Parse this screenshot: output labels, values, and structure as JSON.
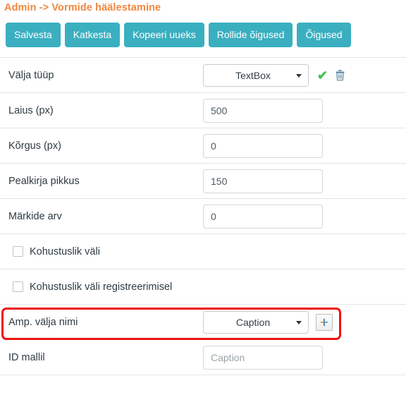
{
  "header": {
    "title": "Admin -> Vormide häälestamine",
    "color": "#f0883e"
  },
  "toolbar": {
    "accent_color": "#3aafc0",
    "buttons": [
      {
        "label": "Salvesta",
        "name": "save-button"
      },
      {
        "label": "Katkesta",
        "name": "cancel-button"
      },
      {
        "label": "Kopeeri uueks",
        "name": "copy-as-new-button"
      },
      {
        "label": "Rollide õigused",
        "name": "role-permissions-button"
      },
      {
        "label": "Õigused",
        "name": "permissions-button"
      }
    ]
  },
  "form": {
    "rows": {
      "field_type": {
        "label": "Välja tüüp",
        "value": "TextBox",
        "confirm_icon": "check-icon",
        "delete_icon": "trash-icon"
      },
      "width": {
        "label": "Laius (px)",
        "value": "500"
      },
      "height": {
        "label": "Kõrgus (px)",
        "value": "0"
      },
      "caption_length": {
        "label": "Pealkirja pikkus",
        "value": "150"
      },
      "char_count": {
        "label": "Märkide arv",
        "value": "0"
      },
      "required": {
        "label": "Kohustuslik väli",
        "checked": false
      },
      "required_registration": {
        "label": "Kohustuslik väli registreerimisel",
        "checked": false
      },
      "amp_field_name": {
        "label": "Amp. välja nimi",
        "value": "Caption",
        "add_label": "+",
        "highlight_color": "#ee1111"
      },
      "id_template": {
        "label": "ID mallil",
        "value": "",
        "placeholder": "Caption"
      }
    }
  }
}
